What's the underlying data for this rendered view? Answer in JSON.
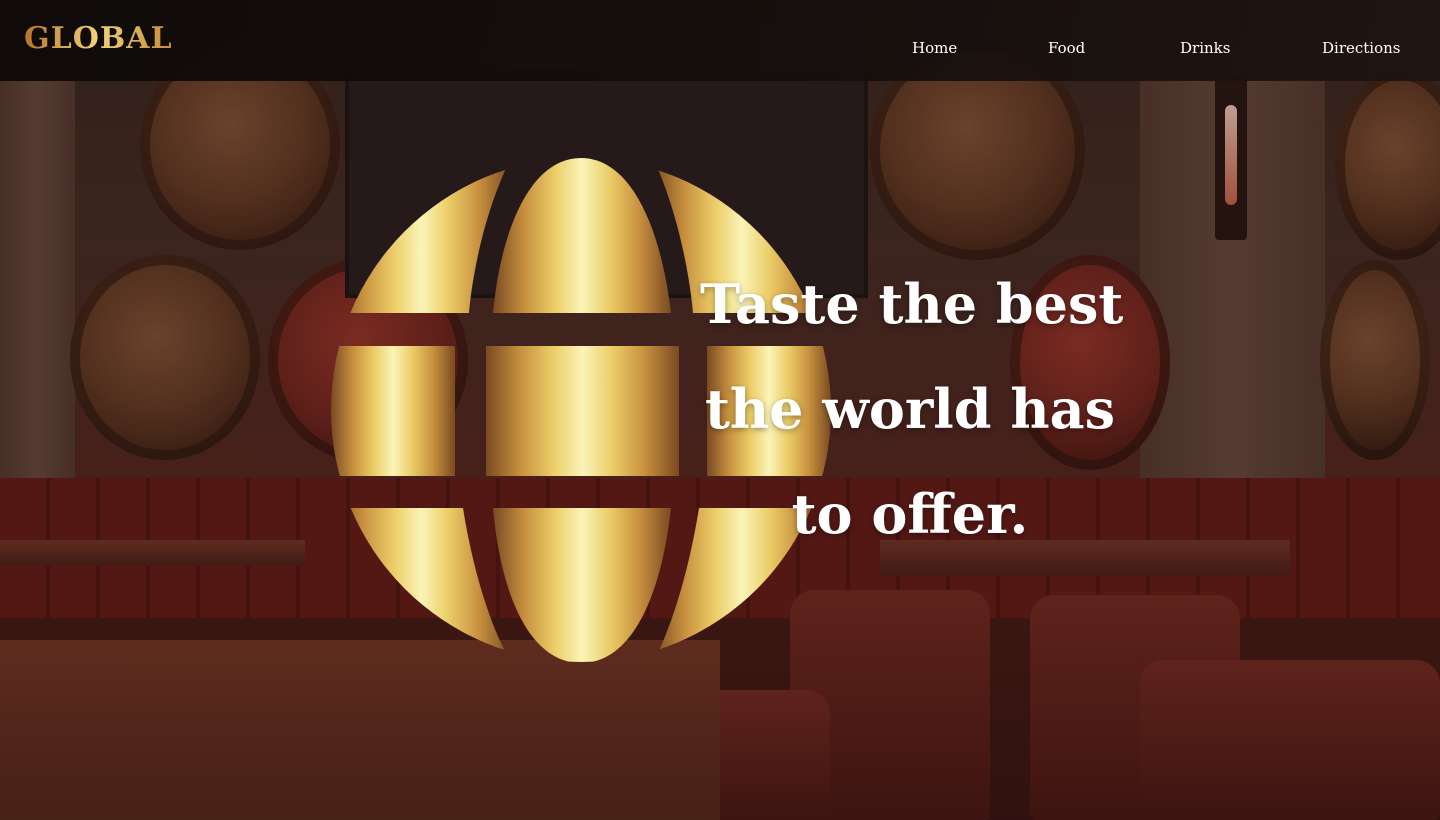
{
  "header": {
    "brand": "GLOBAL",
    "nav": [
      {
        "label": "Home"
      },
      {
        "label": "Food"
      },
      {
        "label": "Drinks"
      },
      {
        "label": "Directions"
      }
    ]
  },
  "hero": {
    "headline_lines": [
      "Taste the best",
      "the world has",
      "to offer."
    ],
    "logo_icon": "globe-icon",
    "background_image": "restaurant-interior-photo"
  },
  "colors": {
    "header_bg": "#141010",
    "gold_dark": "#b8722a",
    "gold_light": "#f9f3b0",
    "text": "#ffffff"
  }
}
